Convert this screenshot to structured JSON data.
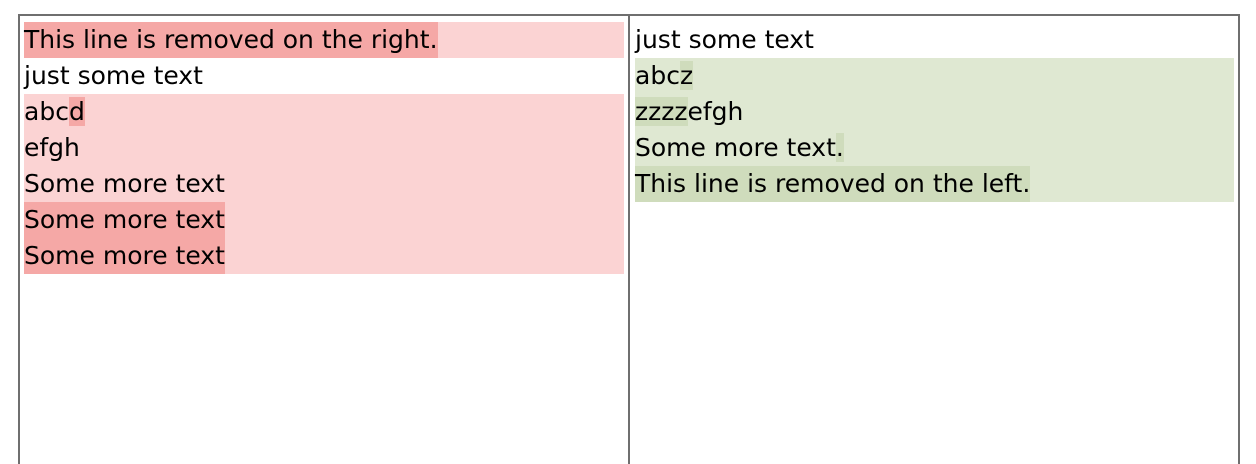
{
  "left_pane": {
    "lines": [
      {
        "text": "This line is removed on the right.",
        "kind": "removed"
      },
      {
        "text": "just some text",
        "kind": "same"
      },
      {
        "text": "abcd",
        "kind": "changed"
      },
      {
        "text": "efgh",
        "kind": "changed"
      },
      {
        "text": "Some more text",
        "kind": "changed"
      },
      {
        "text": "Some more text",
        "kind": "removed"
      },
      {
        "text": "Some more text",
        "kind": "removed"
      }
    ]
  },
  "right_pane": {
    "lines": [
      {
        "text": "just some text",
        "kind": "same"
      },
      {
        "text": "abcz",
        "kind": "changed"
      },
      {
        "text": "zzzzefgh",
        "kind": "changed"
      },
      {
        "text": "Some more text.",
        "kind": "changed"
      },
      {
        "text": "This line is removed on the left.",
        "kind": "added"
      }
    ]
  },
  "colors": {
    "removed_bg": "#fbd3d3",
    "removed_highlight": "#f5a8a6",
    "added_bg": "#dfe8d2",
    "added_highlight": "#cfdcbc",
    "divider": "#6f6f6f"
  }
}
